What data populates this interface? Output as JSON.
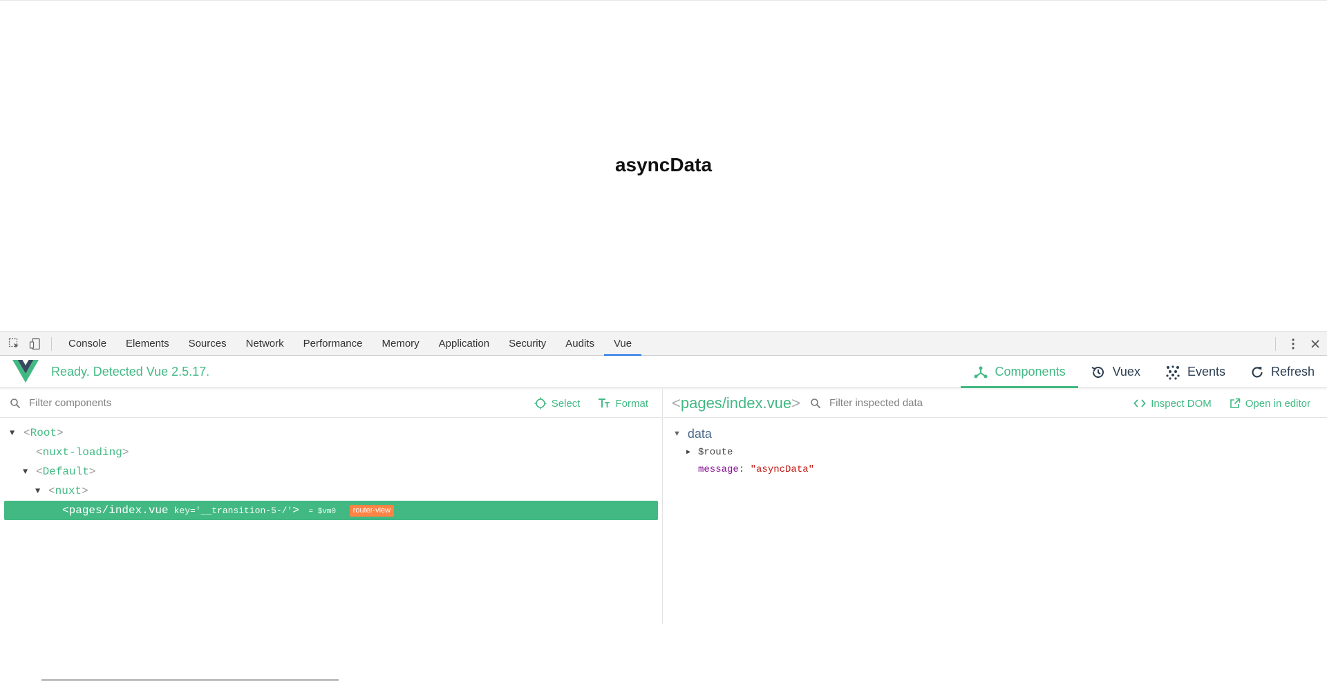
{
  "page": {
    "heading": "asyncData"
  },
  "devtools": {
    "tabs": [
      "Console",
      "Elements",
      "Sources",
      "Network",
      "Performance",
      "Memory",
      "Application",
      "Security",
      "Audits",
      "Vue"
    ],
    "active_tab": "Vue",
    "accent": "#1a73e8"
  },
  "vue": {
    "status": "Ready. Detected Vue 2.5.17.",
    "brand_color": "#42b983",
    "nav": {
      "components": "Components",
      "vuex": "Vuex",
      "events": "Events",
      "refresh": "Refresh"
    },
    "left": {
      "filter_placeholder": "Filter components",
      "select_label": "Select",
      "format_label": "Format",
      "tree": [
        {
          "name": "Root",
          "expanded": true
        },
        {
          "name": "nuxt-loading"
        },
        {
          "name": "Default",
          "expanded": true
        },
        {
          "name": "nuxt",
          "expanded": true
        },
        {
          "name": "pages/index.vue",
          "selected": true,
          "attr": "key='__transition-5-/'",
          "vm": "= $vm0",
          "badge": "router-view"
        }
      ]
    },
    "right": {
      "component_title": "pages/index.vue",
      "filter_placeholder": "Filter inspected data",
      "inspect_dom_label": "Inspect DOM",
      "open_editor_label": "Open in editor",
      "section": "data",
      "rows": [
        {
          "key": "$route",
          "collapsed": true
        },
        {
          "key": "message",
          "value": "\"asyncData\""
        }
      ]
    }
  }
}
